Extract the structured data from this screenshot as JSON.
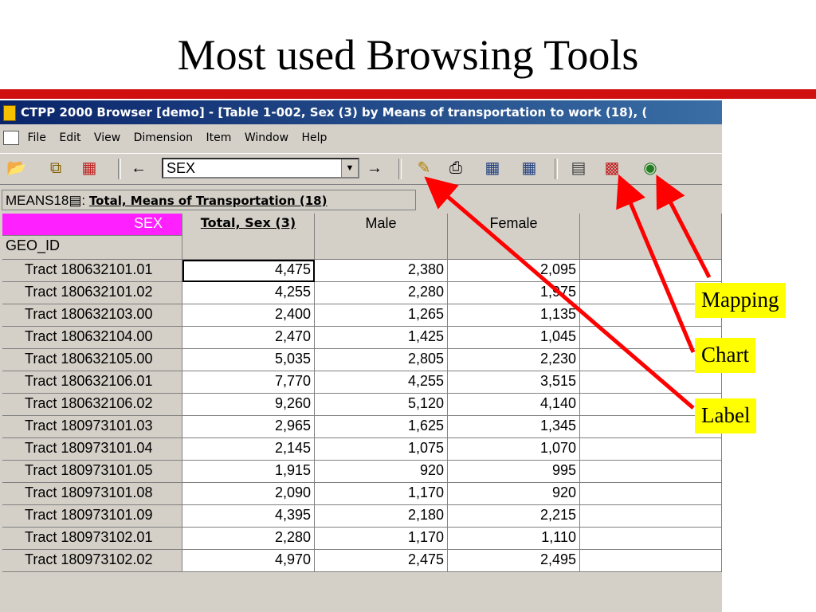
{
  "slide": {
    "title": "Most used Browsing Tools"
  },
  "window": {
    "title": "CTPP 2000 Browser [demo] - [Table 1-002, Sex (3) by Means of transportation to work (18), (",
    "menu": [
      "File",
      "Edit",
      "View",
      "Dimension",
      "Item",
      "Window",
      "Help"
    ],
    "dimension_select": "SEX",
    "measure_label": "MEANS18",
    "measure_value": "Total, Means of Transportation (18)"
  },
  "grid": {
    "sex_header": "SEX",
    "geo_header": "GEO_ID",
    "columns": [
      "Total, Sex (3)",
      "Male",
      "Female"
    ],
    "rows": [
      {
        "id": "Tract 180632101.01",
        "total": "4,475",
        "male": "2,380",
        "female": "2,095"
      },
      {
        "id": "Tract 180632101.02",
        "total": "4,255",
        "male": "2,280",
        "female": "1,975"
      },
      {
        "id": "Tract 180632103.00",
        "total": "2,400",
        "male": "1,265",
        "female": "1,135"
      },
      {
        "id": "Tract 180632104.00",
        "total": "2,470",
        "male": "1,425",
        "female": "1,045"
      },
      {
        "id": "Tract 180632105.00",
        "total": "5,035",
        "male": "2,805",
        "female": "2,230"
      },
      {
        "id": "Tract 180632106.01",
        "total": "7,770",
        "male": "4,255",
        "female": "3,515"
      },
      {
        "id": "Tract 180632106.02",
        "total": "9,260",
        "male": "5,120",
        "female": "4,140"
      },
      {
        "id": "Tract 180973101.03",
        "total": "2,965",
        "male": "1,625",
        "female": "1,345"
      },
      {
        "id": "Tract 180973101.04",
        "total": "2,145",
        "male": "1,075",
        "female": "1,070"
      },
      {
        "id": "Tract 180973101.05",
        "total": "1,915",
        "male": "920",
        "female": "995"
      },
      {
        "id": "Tract 180973101.08",
        "total": "2,090",
        "male": "1,170",
        "female": "920"
      },
      {
        "id": "Tract 180973101.09",
        "total": "4,395",
        "male": "2,180",
        "female": "2,215"
      },
      {
        "id": "Tract 180973102.01",
        "total": "2,280",
        "male": "1,170",
        "female": "1,110"
      },
      {
        "id": "Tract 180973102.02",
        "total": "4,970",
        "male": "2,475",
        "female": "2,495"
      }
    ]
  },
  "callouts": {
    "mapping": "Mapping",
    "chart": "Chart",
    "label": "Label"
  },
  "colors": {
    "rule": "#d01010",
    "arrow": "#ff0000",
    "callout_bg": "#ffff00",
    "sex_header_bg": "#ff20ff"
  },
  "icons": [
    "open-folder-icon",
    "copy-icon",
    "book-icon",
    "back-arrow-icon",
    "forward-arrow-icon",
    "label-tag-icon",
    "print-icon",
    "calculator-icon",
    "table-icon",
    "chart-icon",
    "globe-icon"
  ]
}
